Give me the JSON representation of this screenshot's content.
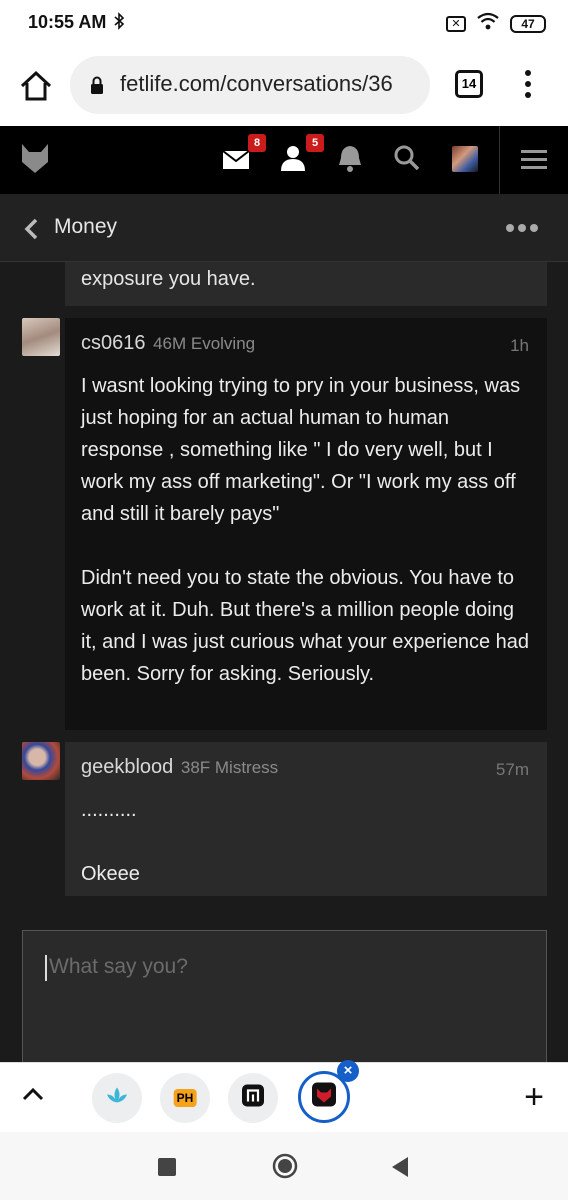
{
  "status_bar": {
    "time": "10:55 AM",
    "battery": "47"
  },
  "browser": {
    "url": "fetlife.com/conversations/36",
    "tab_count": "14"
  },
  "site_nav": {
    "messages_count": "8",
    "friends_count": "5"
  },
  "conversation": {
    "title": "Money",
    "previous_snippet": "exposure you have.",
    "messages": [
      {
        "username": "cs0616",
        "meta": "46M Evolving",
        "time": "1h",
        "text": "I wasnt looking trying to pry in your business, was just hoping for an actual human to human response , something like \" I do very well, but I work my ass off marketing\". Or \"I work my ass off and still it barely pays\"\n\nDidn't need you to state the obvious. You have to work at it. Duh. But there's a million people doing it, and I was just curious what your experience had been. Sorry for asking. Seriously."
      },
      {
        "username": "geekblood",
        "meta": "38F Mistress",
        "time": "57m",
        "text": "..........\n\nOkeee"
      }
    ],
    "reply_placeholder": "What say you?"
  },
  "tray": {
    "app_ph_label": "PH"
  },
  "colors": {
    "accent_blue": "#1560c8",
    "badge_red": "#cc1b1b",
    "nav_black": "#000000"
  }
}
